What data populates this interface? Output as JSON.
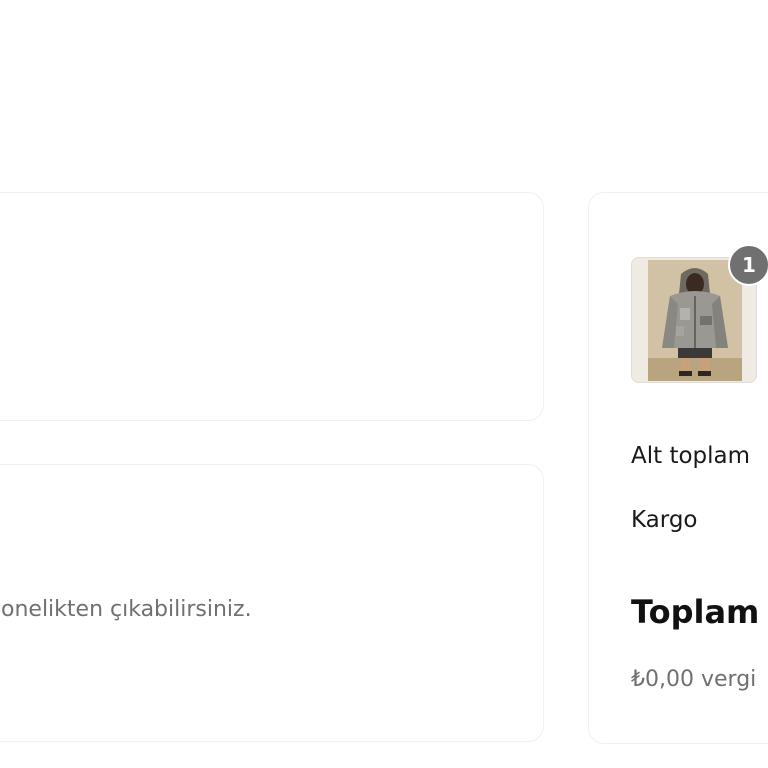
{
  "newsletter": {
    "unsubscribe_text": "onelikten çıkabilirsiniz."
  },
  "order_summary": {
    "item": {
      "quantity": "1",
      "image_icon": "product-thumbnail"
    },
    "subtotal_label": "Alt toplam",
    "shipping_label": "Kargo",
    "total_label": "Toplam",
    "tax_note": "₺0,00 vergi"
  },
  "colors": {
    "card_border": "#f0f0f0",
    "badge_bg": "#707070",
    "muted_text": "#707070"
  }
}
